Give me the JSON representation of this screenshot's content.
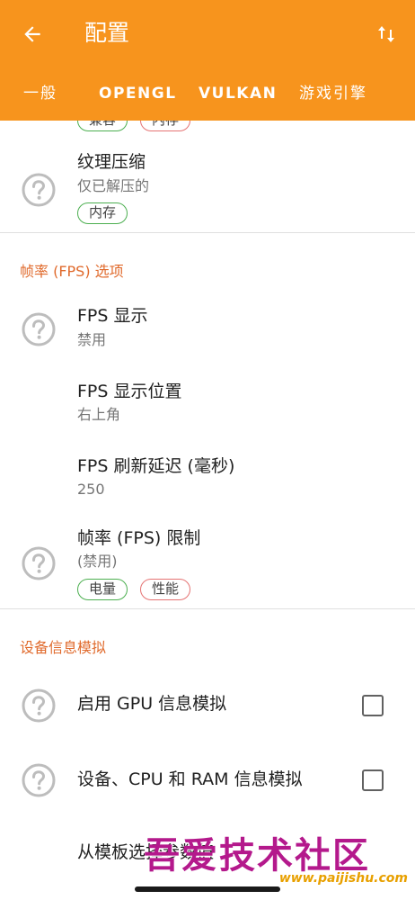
{
  "appbar": {
    "title": "配置",
    "back_icon": "arrow-left-icon",
    "sort_icon": "sort-arrows-icon"
  },
  "tabs": [
    "一般",
    "OPENGL",
    "VULKAN",
    "游戏引擎"
  ],
  "colors": {
    "accent": "#f7941d",
    "section": "#e06a2c",
    "tag_green": "#4caf50",
    "tag_red": "#e57373"
  },
  "partial_tags": [
    "兼容",
    "内存"
  ],
  "texture": {
    "title": "纹理压缩",
    "value": "仅已解压的",
    "tags": [
      "内存"
    ]
  },
  "fps_section": {
    "header": "帧率 (FPS) 选项",
    "items": [
      {
        "title": "FPS 显示",
        "value": "禁用"
      },
      {
        "title": "FPS 显示位置",
        "value": "右上角"
      },
      {
        "title": "FPS 刷新延迟 (毫秒)",
        "value": "250"
      },
      {
        "title": "帧率 (FPS) 限制",
        "value": "(禁用)",
        "tags": [
          "电量",
          "性能"
        ]
      }
    ]
  },
  "device_section": {
    "header": "设备信息模拟",
    "items": [
      {
        "title": "启用 GPU 信息模拟",
        "checked": false
      },
      {
        "title": "设备、CPU 和 RAM 信息模拟",
        "checked": false
      },
      {
        "title": "从模板选择参数值"
      }
    ]
  },
  "watermark": {
    "text": "吾爱技术社区",
    "url": "www.paijishu.com"
  }
}
